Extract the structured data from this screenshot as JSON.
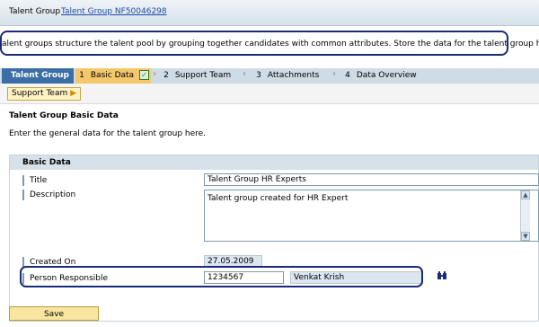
{
  "header": {
    "title": "Talent Group",
    "link": "Talent Group NF50046298"
  },
  "intro": "alent groups structure the talent pool by grouping together candidates with common attributes. Store the data for the talent group here.",
  "roadmap": {
    "main": "Talent Group",
    "steps": [
      {
        "num": "1",
        "label": "Basic Data"
      },
      {
        "num": "2",
        "label": "Support Team"
      },
      {
        "num": "3",
        "label": "Attachments"
      },
      {
        "num": "4",
        "label": "Data Overview"
      }
    ]
  },
  "crumb": "Support Team",
  "section": {
    "title": "Talent Group Basic Data",
    "desc": "Enter the general data for the talent group here."
  },
  "panel": {
    "title": "Basic Data"
  },
  "form": {
    "title_label": "Title",
    "title_value": "Talent Group HR Experts",
    "desc_label": "Description",
    "desc_value": "Talent group created for HR Expert",
    "created_label": "Created On",
    "created_value": "27.05.2009",
    "person_label": "Person Responsible",
    "person_id": "1234567",
    "person_name": "Venkat Krish"
  },
  "buttons": {
    "save": "Save"
  }
}
